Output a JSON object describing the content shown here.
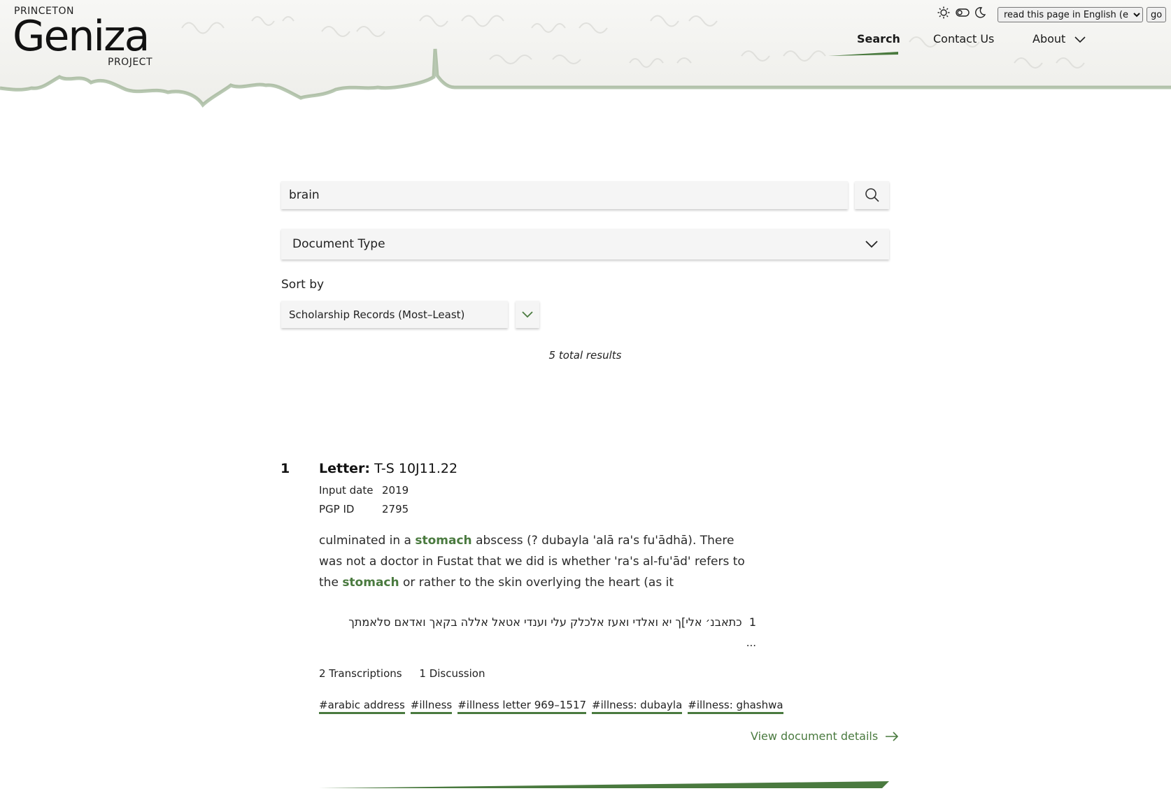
{
  "logo": {
    "top": "PRINCETON",
    "main": "Geniza",
    "bottom": "PROJECT"
  },
  "theme": {
    "light_icon": "sun-icon",
    "contrast_icon": "toggle-icon",
    "dark_icon": "moon-icon"
  },
  "language": {
    "selected": "read this page in English (en)",
    "go_label": "go"
  },
  "nav": {
    "search": "Search",
    "contact": "Contact Us",
    "about": "About"
  },
  "search": {
    "query": "brain",
    "button_icon": "search-icon"
  },
  "filters": {
    "document_type": "Document Type"
  },
  "sort": {
    "label": "Sort by",
    "selected": "Scholarship Records (Most–Least)"
  },
  "results": {
    "total": "5 total results",
    "items": [
      {
        "number": "1",
        "type": "Letter:",
        "shelfmark": "T-S 10J11.22",
        "input_date_label": "Input date",
        "input_date": "2019",
        "pgp_id_label": "PGP ID",
        "pgp_id": "2795",
        "snippet_parts": {
          "p1": "culminated in a ",
          "h1": "stomach",
          "p2": " abscess (? dubayla 'alā ra's fu'ādhā). There was not a doctor in Fustat that we did is whether 'ra's al-fu'ād' refers to the ",
          "h2": "stomach",
          "p3": " or rather to the skin overlying the heart (as it"
        },
        "transcription_line_no": "1",
        "transcription_line": "כתאבנ׳ אלי]ך יא ואלדי ואעז אלכלק עלי וענדי אטאל אללה בקאך ואדאם סלאמתך",
        "ellipsis": "...",
        "transcriptions": "2 Transcriptions",
        "discussions": "1 Discussion",
        "tags": [
          "#arabic address",
          "#illness",
          "#illness letter 969–1517",
          "#illness: dubayla",
          "#illness: ghashwa"
        ],
        "details_link": "View document details"
      }
    ]
  },
  "colors": {
    "accent": "#4a7a3f",
    "field_bg": "#f5f5f5"
  }
}
